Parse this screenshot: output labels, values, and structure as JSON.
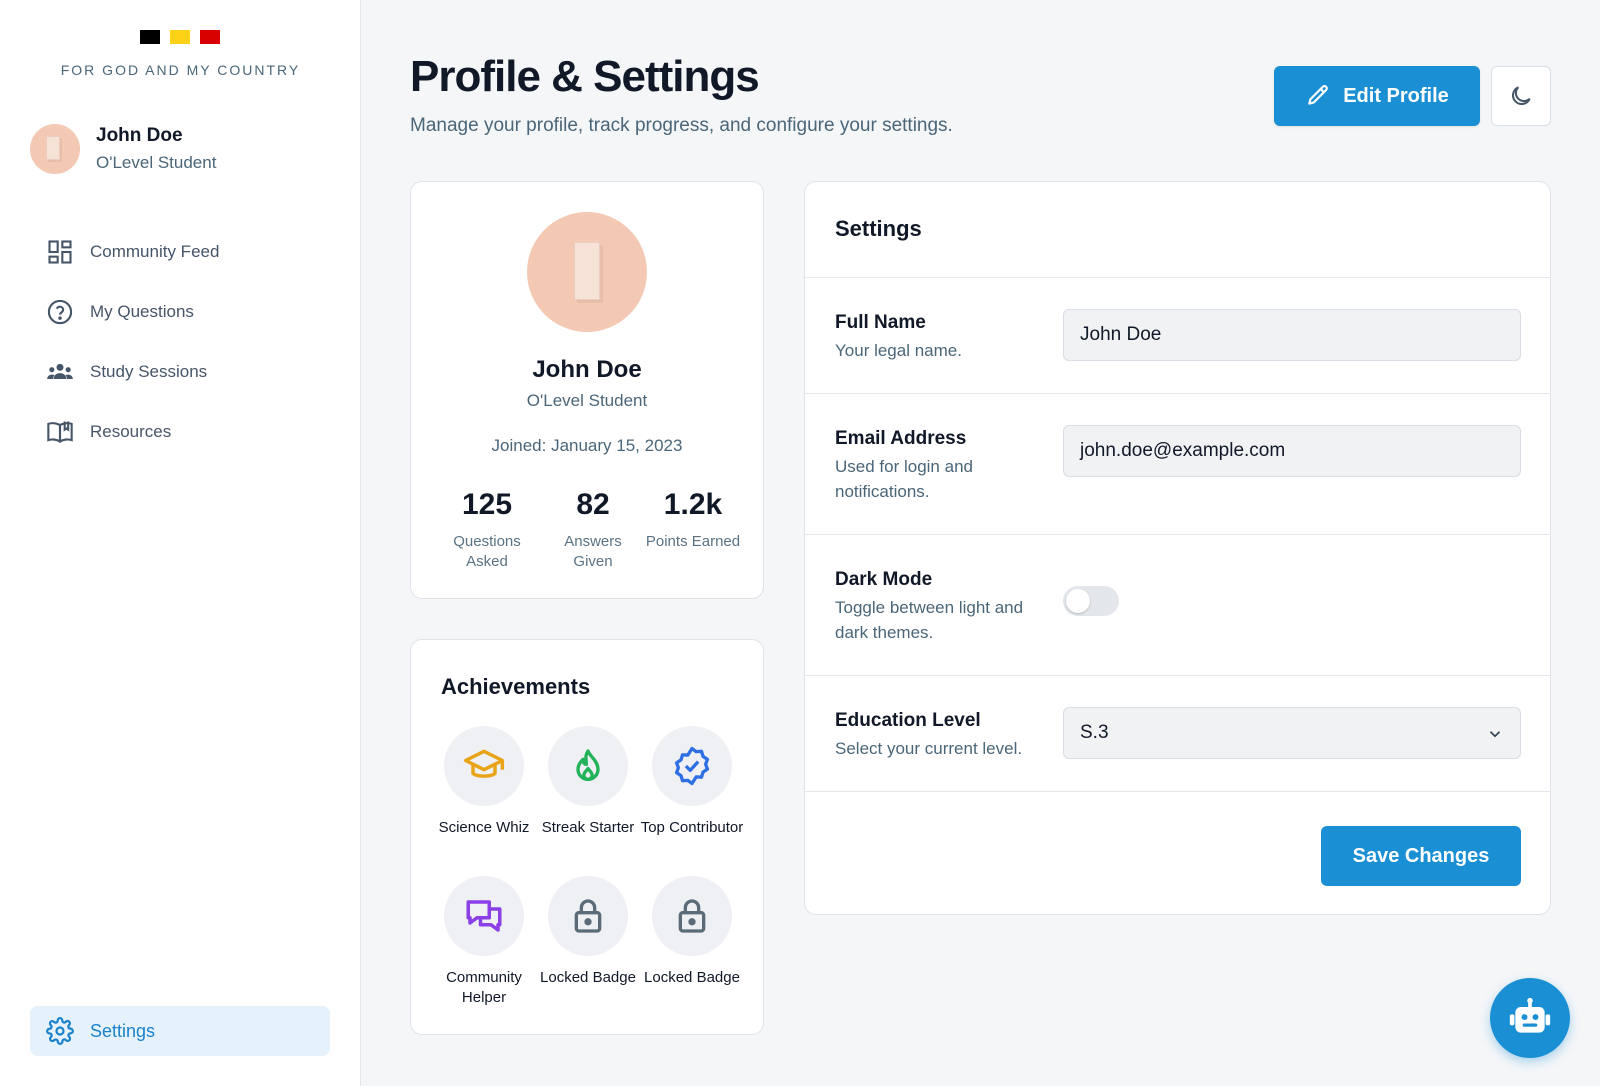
{
  "brand": {
    "flag_colors": [
      "#000000",
      "#fcd116",
      "#d90000"
    ],
    "motto": "FOR GOD AND MY COUNTRY"
  },
  "sidebar": {
    "user": {
      "name": "John Doe",
      "role": "O'Level Student"
    },
    "items": [
      {
        "label": "Community Feed",
        "icon": "dashboard-icon"
      },
      {
        "label": "My Questions",
        "icon": "question-circle-icon"
      },
      {
        "label": "Study Sessions",
        "icon": "group-icon"
      },
      {
        "label": "Resources",
        "icon": "book-icon"
      }
    ],
    "settings": {
      "label": "Settings",
      "icon": "gear-icon",
      "active": true
    }
  },
  "header": {
    "title": "Profile & Settings",
    "subtitle": "Manage your profile, track progress, and configure your settings.",
    "edit_label": "Edit Profile",
    "theme_icon": "moon-icon"
  },
  "profile": {
    "name": "John Doe",
    "role": "O'Level Student",
    "joined": "Joined: January 15, 2023",
    "stats": [
      {
        "value": "125",
        "label": "Questions Asked"
      },
      {
        "value": "82",
        "label": "Answers Given"
      },
      {
        "value": "1.2k",
        "label": "Points Earned"
      }
    ]
  },
  "achievements": {
    "title": "Achievements",
    "badges": [
      {
        "label": "Science Whiz",
        "icon": "graduation-cap-icon",
        "color": "#e8a317"
      },
      {
        "label": "Streak Starter",
        "icon": "flame-icon",
        "color": "#22b35b"
      },
      {
        "label": "Top Contributor",
        "icon": "verified-badge-icon",
        "color": "#2f6fe4"
      },
      {
        "label": "Community Helper",
        "icon": "chat-bubbles-icon",
        "color": "#8b3fe6"
      },
      {
        "label": "Locked Badge",
        "icon": "lock-icon",
        "color": "#5b6b78"
      },
      {
        "label": "Locked Badge",
        "icon": "lock-icon",
        "color": "#5b6b78"
      }
    ]
  },
  "settings": {
    "title": "Settings",
    "full_name": {
      "title": "Full Name",
      "desc": "Your legal name.",
      "value": "John Doe"
    },
    "email": {
      "title": "Email Address",
      "desc": "Used for login and notifications.",
      "value": "john.doe@example.com"
    },
    "dark_mode": {
      "title": "Dark Mode",
      "desc": "Toggle between light and dark themes.",
      "enabled": false
    },
    "education": {
      "title": "Education Level",
      "desc": "Select your current level.",
      "value": "S.3"
    },
    "save_label": "Save Changes"
  },
  "assistant": {
    "icon": "robot-icon"
  },
  "colors": {
    "accent": "#1a8fd4",
    "muted_text": "#4b6678"
  }
}
